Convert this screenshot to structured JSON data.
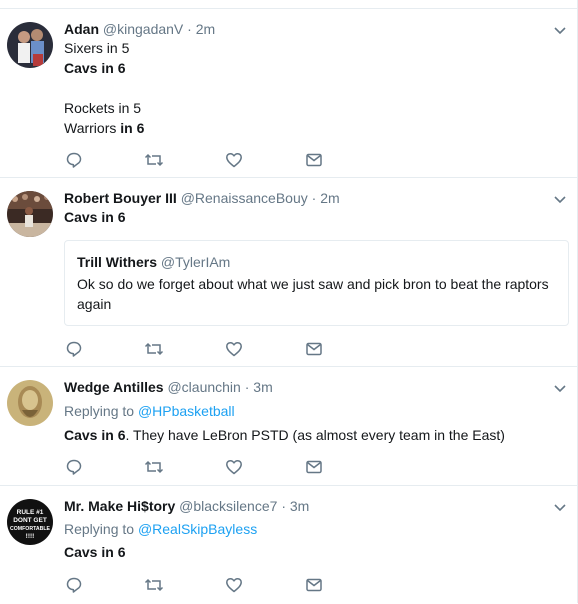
{
  "tweets": [
    {
      "name": "Adan",
      "handle": "@kingadanV",
      "time": "2m",
      "lines": [
        {
          "a": "Sixers in 5"
        },
        {
          "b": "Cavs in 6"
        },
        {
          "a": "Rockets in 5"
        },
        {
          "a": "Warriors ",
          "b": "in 6"
        }
      ],
      "icons": [
        "reply-icon",
        "retweet-icon",
        "like-icon",
        "direct-message-icon"
      ]
    },
    {
      "name": "Robert Bouyer III",
      "handle": "@RenaissanceBouy",
      "time": "2m",
      "text_bold": "Cavs in 6",
      "quote": {
        "name": "Trill Withers",
        "handle": "@TylerIAm",
        "text_line1": "Ok so do we forget about what we just saw and pick bron to beat the raptors",
        "text_line2": "again"
      }
    },
    {
      "name": "Wedge Antilles",
      "handle": "@claunchin",
      "time": "3m",
      "replying_prefix": "Replying to ",
      "replying_to": "@HPbasketball",
      "text_bold": "Cavs in 6",
      "text_rest": ". They have LeBron PSTD (as almost every team in the East)"
    },
    {
      "name": "Mr. Make Hi$tory",
      "handle": "@blacksilence7",
      "time": "3m",
      "replying_prefix": "Replying to ",
      "replying_to": "@RealSkipBayless",
      "text_bold": "Cavs in 6",
      "avatar_text": [
        "RULE #1",
        "DONT GET",
        "COMFORTABLE",
        "!!!!"
      ]
    }
  ],
  "separator": "·",
  "colors": {
    "link": "#1da1f2",
    "muted": "#657786",
    "border": "#e6ecf0",
    "text": "#14171a"
  }
}
